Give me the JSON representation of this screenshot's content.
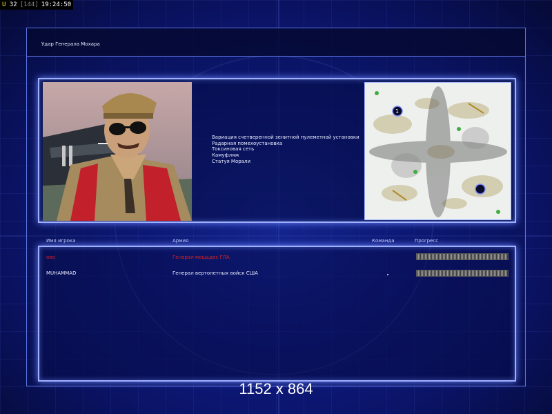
{
  "hud": {
    "unit_label": "U",
    "unit_count": "32",
    "bracket_value": "[144]",
    "clock": "19:24:50"
  },
  "mission": {
    "title": "Удар Генерала Мохара",
    "briefing_lines": [
      "Вариация счетверенной зенитной пулеметной установки",
      "Радарная помехоустановка",
      "Токсиновая сеть",
      "Камуфляж",
      "Статуя Морали"
    ]
  },
  "table": {
    "headers": {
      "player": "Имя игрока",
      "army": "Армия",
      "team": "Команда",
      "progress": "Прогресс"
    },
    "rows": [
      {
        "player": "ooo",
        "army": "Генерал мощьдес ГЛА",
        "team": "",
        "progress_fraction": 1.0,
        "color": "#e02020"
      },
      {
        "player": "MUHAMMAD",
        "army": "Генерал вертолетных войск США",
        "team": "·",
        "progress_fraction": 1.0,
        "color": "#e8ecff"
      }
    ]
  },
  "footer": {
    "resolution_caption": "1152 x 864"
  },
  "colors": {
    "frame_glow": "#9fb0ff",
    "background": "#0f1c86",
    "enemy_red": "#e02020"
  }
}
